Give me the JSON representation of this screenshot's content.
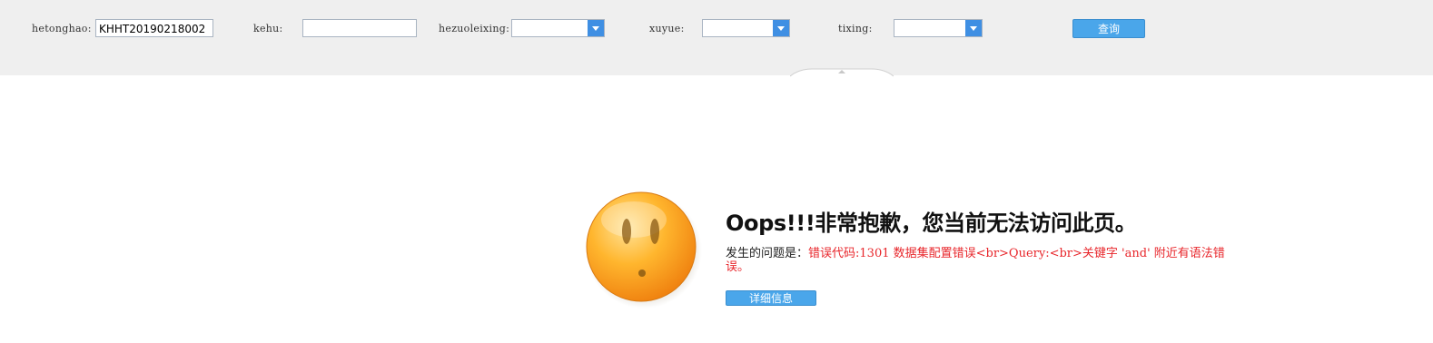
{
  "filters": {
    "hetonghao": {
      "label": "hetonghao:",
      "value": "KHHT20190218002",
      "placeholder": ""
    },
    "kehu": {
      "label": "kehu:",
      "value": "",
      "placeholder": ""
    },
    "hezuoleixing": {
      "label": "hezuoleixing:",
      "selected": ""
    },
    "xuyue": {
      "label": "xuyue:",
      "selected": ""
    },
    "tixing": {
      "label": "tixing:",
      "selected": ""
    },
    "search_label": "查询"
  },
  "error": {
    "title": "Oops!!!非常抱歉，您当前无法访问此页。",
    "prefix": "发生的问题是：",
    "message": "错误代码:1301 数据集配置错误<br>Query:<br>关键字 'and' 附近有语法错误。",
    "detail_label": "详细信息"
  },
  "colors": {
    "accent": "#4aa6ea",
    "dropdown_arrow": "#3f8fe3",
    "error_text": "#e8262b",
    "face_orange": "#ffa726"
  },
  "icons": {
    "face": "sad-face-icon",
    "dropdown": "chevron-down-icon",
    "collapse": "chevron-up-icon"
  }
}
